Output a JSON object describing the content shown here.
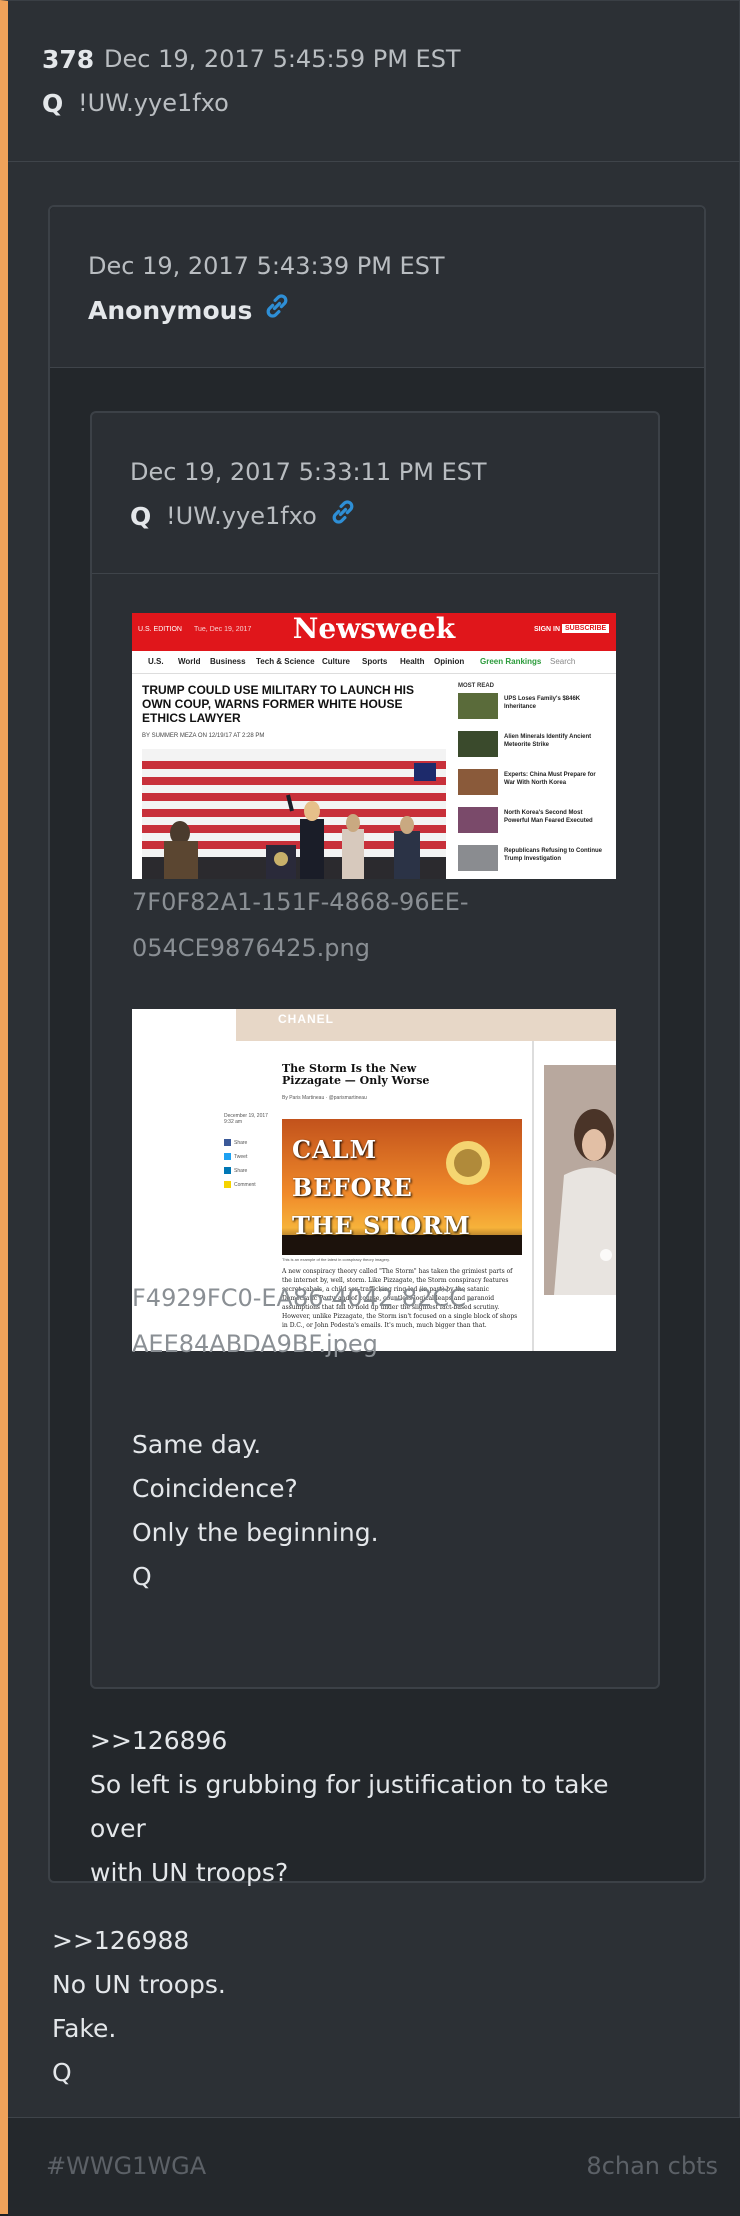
{
  "post": {
    "number": "378",
    "date": "Dec 19, 2017 5:45:59 PM EST",
    "name": "Q",
    "trip": "!UW.yye1fxo",
    "text_lines": [
      ">>126988",
      "No UN troops.",
      "Fake.",
      "Q"
    ]
  },
  "quoted": {
    "date": "Dec 19, 2017 5:43:39 PM EST",
    "name": "Anonymous",
    "text_lines": [
      ">>126896",
      "So left is grubbing for justification to take over",
      "with UN troops?"
    ]
  },
  "nested": {
    "date": "Dec 19, 2017 5:33:11 PM EST",
    "name": "Q",
    "trip": "!UW.yye1fxo",
    "image1": {
      "filename_lines": [
        "7F0F82A1-151F-4868-96EE-",
        "054CE9876425.png"
      ],
      "logo": "Newsweek",
      "edition": "U.S. EDITION",
      "date_small": "Tue, Dec 19, 2017",
      "sign_in": "SIGN IN",
      "subscribe": "SUBSCRIBE",
      "nav": [
        "U.S.",
        "World",
        "Business",
        "Tech & Science",
        "Culture",
        "Sports",
        "Health",
        "Opinion",
        "Green Rankings",
        "Search"
      ],
      "headline": "TRUMP COULD USE MILITARY TO LAUNCH HIS OWN COUP, WARNS FORMER WHITE HOUSE ETHICS LAWYER",
      "byline": "BY SUMMER MEZA ON 12/19/17 AT 2:28 PM",
      "most_read_label": "MOST READ",
      "most_read": [
        "UPS Loses Family's $846K Inheritance",
        "Alien Minerals Identify Ancient Meteorite Strike",
        "Experts: China Must Prepare for War With North Korea",
        "North Korea's Second Most Powerful Man Feared Executed",
        "Republicans Refusing to Continue Trump Investigation"
      ]
    },
    "image2": {
      "filename_lines": [
        "F4929FC0-EA86-4042-82CC-",
        "AEE84ABDA9BF.jpeg"
      ],
      "banner": "CHANEL",
      "title": "The Storm Is the New Pizzagate — Only Worse",
      "byline": "By Paris Martineau · @parismartineau",
      "date_small": "December 19, 2017 9:32 am",
      "share": [
        "Share",
        "Tweet",
        "Share",
        "Comment"
      ],
      "image_lines": [
        "CALM",
        "BEFORE",
        "THE STORM"
      ],
      "caption": "This is an example of the latest in conspiracy theory imagery.",
      "body": "A new conspiracy theory called \"The Storm\" has taken the grimiest parts of the internet by, well, storm. Like Pizzagate, the Storm conspiracy features secret cabals, a child sex-trafficking ring led (in part) by the satanic Democratic Party, and of course, countless logical leaps and paranoid assumptions that fall to hold up under the slightest fact-based scrutiny. However, unlike Pizzagate, the Storm isn't focused on a single block of shops in D.C., or John Podesta's emails. It's much, much bigger than that."
    },
    "text_lines": [
      "Same day.",
      "Coincidence?",
      "Only the beginning.",
      "Q"
    ]
  },
  "footer": {
    "hashtag": "#WWG1WGA",
    "source": "8chan cbts"
  },
  "colors": {
    "accent_bar": "#f0a25a",
    "link_icon": "#2e8fd6",
    "newsweek_red": "#e0161b"
  }
}
